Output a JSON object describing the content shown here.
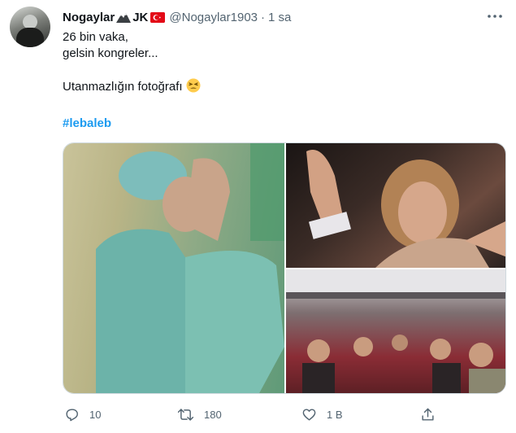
{
  "tweet": {
    "display_name": "Nogaylar",
    "name_suffix": "JK",
    "handle": "@Nogaylar1903",
    "separator": "·",
    "time": "1 sa",
    "lines": [
      "26 bin vaka,",
      "gelsin kongreler...",
      "",
      "Utanmazlığın fotoğrafı"
    ],
    "hashtag": "#lebaleb",
    "emoji": "tired-face-emoji"
  },
  "media": {
    "images": [
      {
        "name": "exhausted-healthcare-worker-photo"
      },
      {
        "name": "woman-cheering-crowd-photo"
      },
      {
        "name": "crowded-bus-passengers-photo"
      }
    ]
  },
  "actions": {
    "reply_count": "10",
    "retweet_count": "180",
    "like_count": "1 B"
  },
  "colors": {
    "text": "#0f1419",
    "secondary": "#536471",
    "link": "#1d9bf0",
    "flag_red": "#e30a17"
  }
}
